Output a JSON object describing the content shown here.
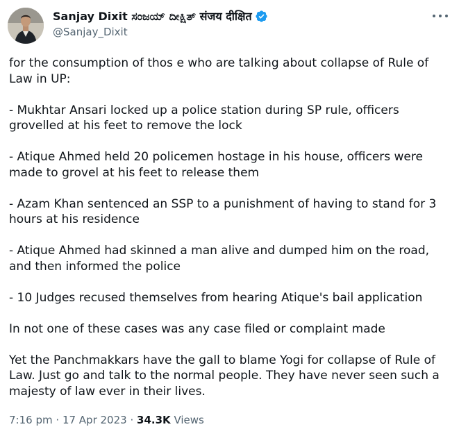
{
  "author": {
    "display_name": "Sanjay Dixit ಸಂಜಯ್ ದೀಕ್ಷಿತ್ संजय दीक्षित",
    "handle": "@Sanjay_Dixit",
    "verified": true,
    "verified_color": "#1d9bf0"
  },
  "tweet": {
    "paragraphs": [
      "for the consumption of thos e who are talking about collapse of Rule of Law in UP:",
      "- Mukhtar Ansari locked up a police station during SP rule, officers grovelled at his feet to remove the lock",
      "- Atique Ahmed held 20 policemen hostage in his house, officers were made to grovel at his feet to release them",
      "- Azam Khan sentenced an SSP to a punishment of having to stand for 3 hours at his residence",
      "- Atique Ahmed had skinned a man alive and dumped him on the road, and then informed the police",
      "- 10 Judges recused themselves from hearing Atique's bail application",
      "In not one of these cases was any case filed or complaint made",
      "Yet the Panchmakkars have the gall to blame Yogi for collapse of Rule of Law. Just go and talk to the normal people. They have never seen such a majesty of law ever in their lives."
    ]
  },
  "meta": {
    "time": "7:16 pm",
    "separator": "·",
    "date": "17 Apr 2023",
    "views_count": "34.3K",
    "views_label": "Views"
  },
  "icons": {
    "more": "more-icon",
    "verified": "verified-badge-icon"
  },
  "colors": {
    "text": "#0f1419",
    "secondary": "#536471",
    "accent": "#1d9bf0"
  }
}
